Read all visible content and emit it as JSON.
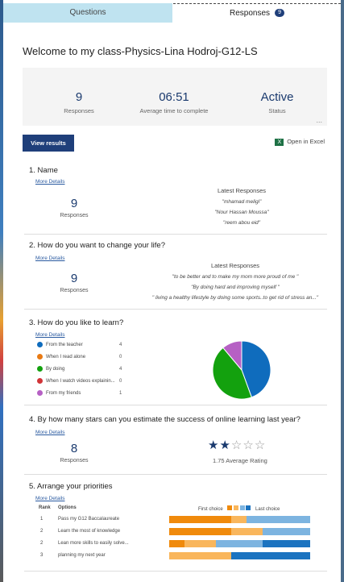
{
  "tabs": {
    "questions": "Questions",
    "responses": "Responses",
    "responses_badge": "9"
  },
  "title": "Welcome to my class-Physics-Lina Hodroj-G12-LS",
  "stats": {
    "responses": "9",
    "responses_label": "Responses",
    "avg_time": "06:51",
    "avg_time_label": "Average time to complete",
    "status": "Active",
    "status_label": "Status",
    "more": "..."
  },
  "view_results": "View results",
  "open_excel": "Open in Excel",
  "more_details": "More Details",
  "q1": {
    "title": "1.  Name",
    "count": "9",
    "count_label": "Responses",
    "latest_label": "Latest Responses",
    "latest": [
      "\"mhamad meligi\"",
      "\"Nour Hassan Moussa\"",
      "\"reem abou eid\""
    ]
  },
  "q2": {
    "title": "2.  How do you want to change your life?",
    "count": "9",
    "count_label": "Responses",
    "latest_label": "Latest Responses",
    "latest": [
      "\"to be better and to make my mom more proud of me \"",
      "\"By doing hard and improving myself \"",
      "\" living a healthy lifestyle by doing some sports..to get rid of stress an...\""
    ]
  },
  "q3": {
    "title": "3.  How do you like to learn?",
    "options": [
      {
        "label": "From the teacher",
        "count": "4",
        "color": "#0f6cbd"
      },
      {
        "label": "When I read alone",
        "count": "0",
        "color": "#e97a13"
      },
      {
        "label": "By doing",
        "count": "4",
        "color": "#13a10e"
      },
      {
        "label": "When I watch videos explainin...",
        "count": "0",
        "color": "#d13438"
      },
      {
        "label": "From my friends",
        "count": "1",
        "color": "#b660c4"
      }
    ]
  },
  "q4": {
    "title": "4.  By how many stars can you estimate the success of online learning last year?",
    "count": "8",
    "count_label": "Responses",
    "rating": 1.75,
    "rating_label": "1.75 Average Rating"
  },
  "q5": {
    "title": "5.  Arrange your priorities",
    "col_rank": "Rank",
    "col_options": "Options",
    "first_choice": "First choice",
    "last_choice": "Last choice",
    "rows": [
      {
        "rank": "1",
        "option": "Pass my G12 Baccalaureate",
        "segs": [
          0.44,
          0.11,
          0.45,
          0
        ]
      },
      {
        "rank": "2",
        "option": "Learn the most of knowledge",
        "segs": [
          0.44,
          0.22,
          0.34,
          0
        ]
      },
      {
        "rank": "2",
        "option": "Lean more skills to easily solve...",
        "segs": [
          0.11,
          0.22,
          0.33,
          0.34
        ]
      },
      {
        "rank": "3",
        "option": "planning my next year",
        "segs": [
          0,
          0.44,
          0,
          0.56
        ]
      }
    ],
    "seg_colors": [
      "#f08a0c",
      "#f9b65c",
      "#7db4e0",
      "#1b73c0"
    ]
  }
}
